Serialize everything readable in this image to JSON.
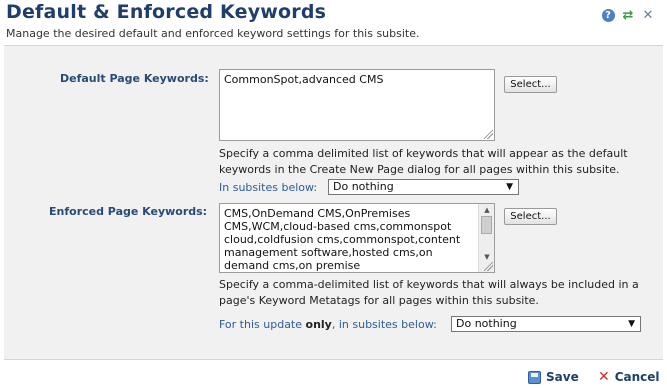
{
  "header": {
    "title": "Default & Enforced Keywords",
    "subtitle": "Manage the desired default and enforced keyword settings for this subsite.",
    "icons": [
      "help-icon",
      "refresh-icon",
      "close-icon"
    ],
    "help_glyph": "?",
    "refresh_glyph": "⇄",
    "close_glyph": "✕"
  },
  "default_keywords": {
    "label": "Default Page Keywords:",
    "value": "CommonSpot,advanced CMS",
    "select_button": "Select...",
    "help_text": "Specify a comma delimited list of keywords that will appear as the default keywords in the Create New Page dialog for all pages within this subsite.",
    "subsites_label": "In subsites below:",
    "subsites_value": "Do nothing"
  },
  "enforced_keywords": {
    "label": "Enforced Page Keywords:",
    "value": "CMS,OnDemand CMS,OnPremises CMS,WCM,cloud-based cms,commonspot cloud,coldfusion cms,commonspot,content management software,hosted cms,on demand cms,on premise",
    "select_button": "Select...",
    "help_text": "Specify a comma-delimited list of keywords that will always be included in a page's Keyword Metatags for all pages within this subsite.",
    "subsites_label_prefix": "For this update ",
    "subsites_label_bold": "only",
    "subsites_label_suffix": ", in subsites below:",
    "subsites_value": "Do nothing"
  },
  "footer": {
    "save_label": "Save",
    "cancel_label": "Cancel"
  },
  "colors": {
    "title": "#1f3e6b",
    "label": "#2a4a76",
    "panel_bg": "#f1f1f1",
    "cancel_icon": "#d42b2b"
  }
}
